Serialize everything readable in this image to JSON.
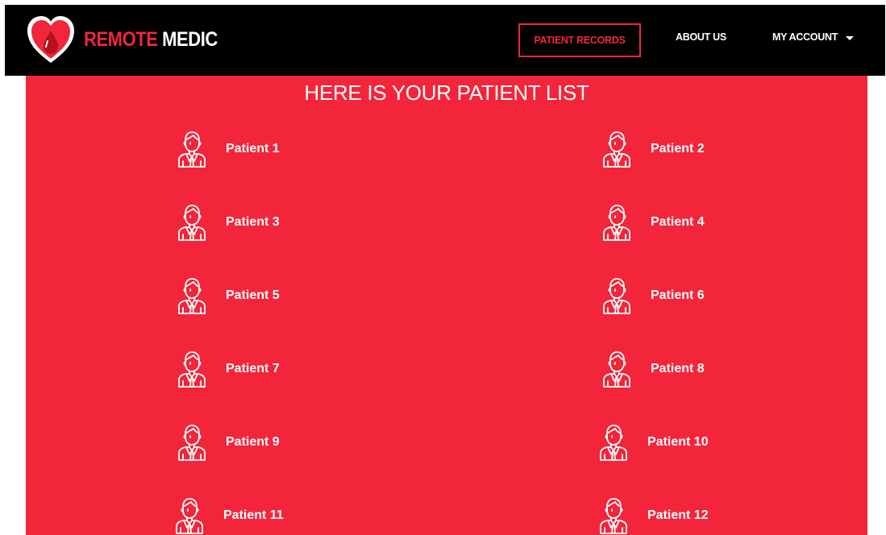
{
  "brand": {
    "name_part1": "REMOTE",
    "name_part2": "MEDIC",
    "logo_icon": "heart-blood-drop-icon"
  },
  "nav": {
    "patient_records": "PATIENT RECORDS",
    "about_us": "ABOUT US",
    "my_account": "MY ACCOUNT"
  },
  "main": {
    "title": "HERE IS YOUR PATIENT LIST",
    "patients": [
      {
        "label": "Patient 1",
        "icon": "patient-avatar-icon"
      },
      {
        "label": "Patient 2",
        "icon": "patient-avatar-icon"
      },
      {
        "label": "Patient 3",
        "icon": "patient-avatar-icon"
      },
      {
        "label": "Patient 4",
        "icon": "patient-avatar-icon"
      },
      {
        "label": "Patient 5",
        "icon": "patient-avatar-icon"
      },
      {
        "label": "Patient 6",
        "icon": "patient-avatar-icon"
      },
      {
        "label": "Patient 7",
        "icon": "patient-avatar-icon"
      },
      {
        "label": "Patient 8",
        "icon": "patient-avatar-icon"
      },
      {
        "label": "Patient 9",
        "icon": "patient-avatar-icon"
      },
      {
        "label": "Patient 10",
        "icon": "patient-avatar-icon"
      },
      {
        "label": "Patient 11",
        "icon": "patient-avatar-icon"
      },
      {
        "label": "Patient 12",
        "icon": "patient-avatar-icon"
      }
    ]
  },
  "colors": {
    "accent": "#f1263a",
    "content_background": "#f3253a",
    "navbar_background": "#000000",
    "text_light": "#ffffff"
  }
}
